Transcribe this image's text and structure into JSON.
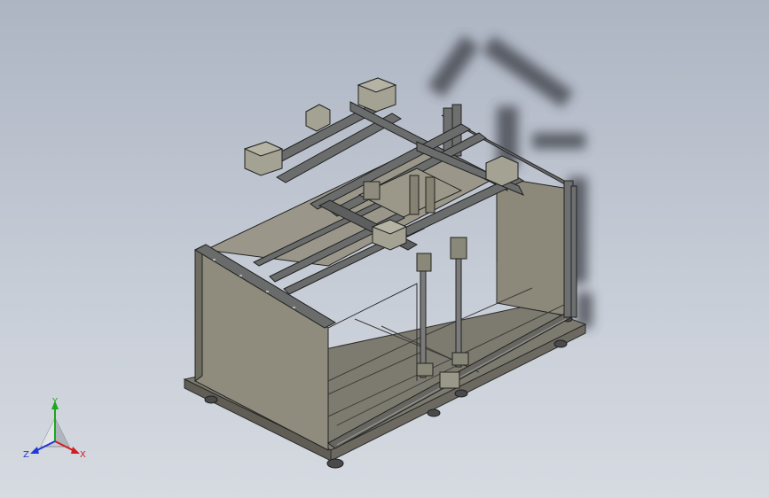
{
  "viewport": {
    "background_top": "#adb5c3",
    "background_bottom": "#d6dae1",
    "model_color": "#8d8a7c",
    "frame_color": "#5e6060",
    "shadow_color": "#3a3d44"
  },
  "triad": {
    "x_label": "X",
    "y_label": "Y",
    "z_label": "Z",
    "x_color": "#d21e1e",
    "y_color": "#1ea51e",
    "z_color": "#2038d6",
    "icon": "coordinate-triad-icon"
  }
}
